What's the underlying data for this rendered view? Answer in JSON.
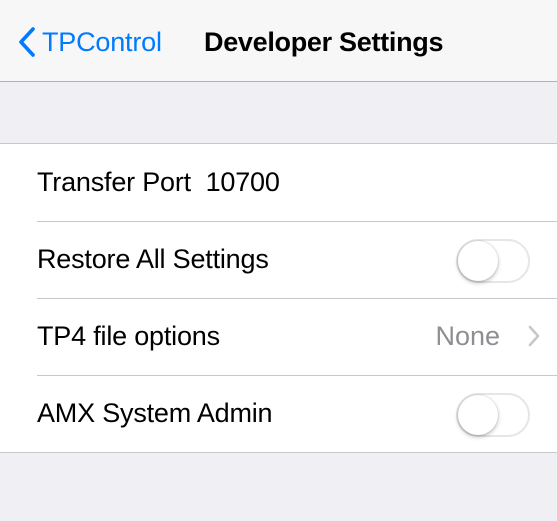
{
  "navbar": {
    "back_label": "TPControl",
    "title": "Developer Settings",
    "accent_color": "#007aff"
  },
  "settings": {
    "transfer_port": {
      "label": "Transfer Port",
      "value": "10700"
    },
    "restore_all": {
      "label": "Restore All Settings",
      "toggle_on": false
    },
    "tp4_options": {
      "label": "TP4 file options",
      "value": "None",
      "icon": "chevron-right-icon"
    },
    "amx_admin": {
      "label": "AMX System Admin",
      "toggle_on": false
    }
  }
}
